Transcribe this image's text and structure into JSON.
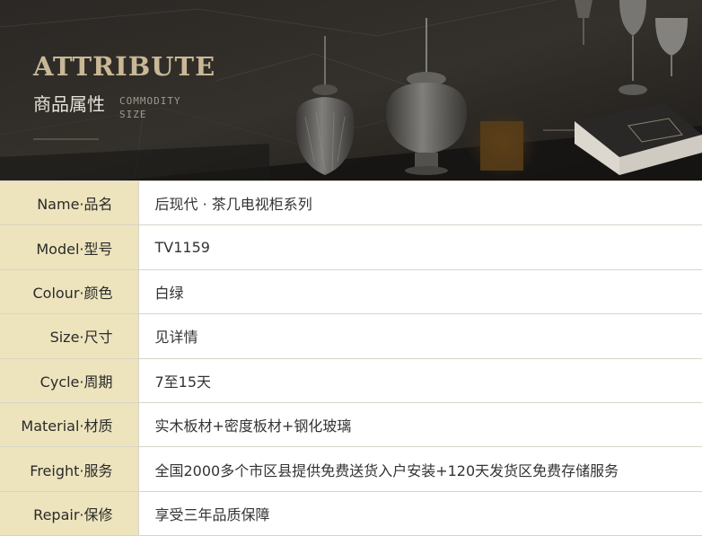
{
  "banner": {
    "title_en": "ATTRIBUTE",
    "title_cn": "商品属性",
    "subtitle_lines": [
      "COMMODITY",
      "SIZE"
    ]
  },
  "attributes": [
    {
      "key": "Name·品名",
      "value": "后现代 · 茶几电视柜系列"
    },
    {
      "key": "Model·型号",
      "value": "TV1159"
    },
    {
      "key": "Colour·颜色",
      "value": "白绿"
    },
    {
      "key": "Size·尺寸",
      "value": "见详情"
    },
    {
      "key": "Cycle·周期",
      "value": "7至15天"
    },
    {
      "key": "Material·材质",
      "value": "实木板材+密度板材+钢化玻璃"
    },
    {
      "key": "Freight·服务",
      "value": "全国2000多个市区县提供免费送货入户安装+120天发货区免费存储服务"
    },
    {
      "key": "Repair·保修",
      "value": "享受三年品质保障"
    }
  ],
  "colors": {
    "key_bg": "#ede4bd",
    "title_gold": "#c8b896",
    "border": "#d8d4c8"
  }
}
